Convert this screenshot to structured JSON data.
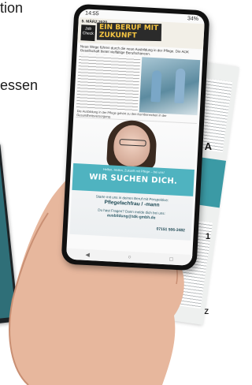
{
  "background": {
    "left_text_1": "tion",
    "left_text_2": "essen",
    "right_label_1": "A",
    "right_label_2": "1",
    "right_label_3": "Z"
  },
  "status_bar": {
    "time": "14:55",
    "battery": "34%"
  },
  "newspaper": {
    "date": "5. MÄRZ 2020",
    "tag": "Job Check",
    "headline": "EIN BERUF MIT ZUKUNFT",
    "subhead": "Neue Wege führen durch die neue Ausbildung in der Pflege. Die AOK Gesellschaft bietet vielfältige Berufschancen.",
    "caption": "Die Ausbildung in der Pflege gehört zu den Kernbereichen in der Gesundheitsversorgung."
  },
  "ad": {
    "tagline": "Wir suchen dich.",
    "banner_small": "Helfen, Heilen, Zukunft mit Pflege – bei uns!",
    "banner_big": "WIR SUCHEN DICH.",
    "line1": "Starte mit uns in deinen Beruf mit Perspektive:",
    "line2": "Pflegefachfrau / -mann",
    "line3": "Du hast Fragen? Dann melde dich bei uns:",
    "line4": "ausbildung@tdk-gmbh.de",
    "phone": "07151 506-3482"
  },
  "icons": [
    "back-icon",
    "home-icon",
    "recent-apps-icon"
  ]
}
